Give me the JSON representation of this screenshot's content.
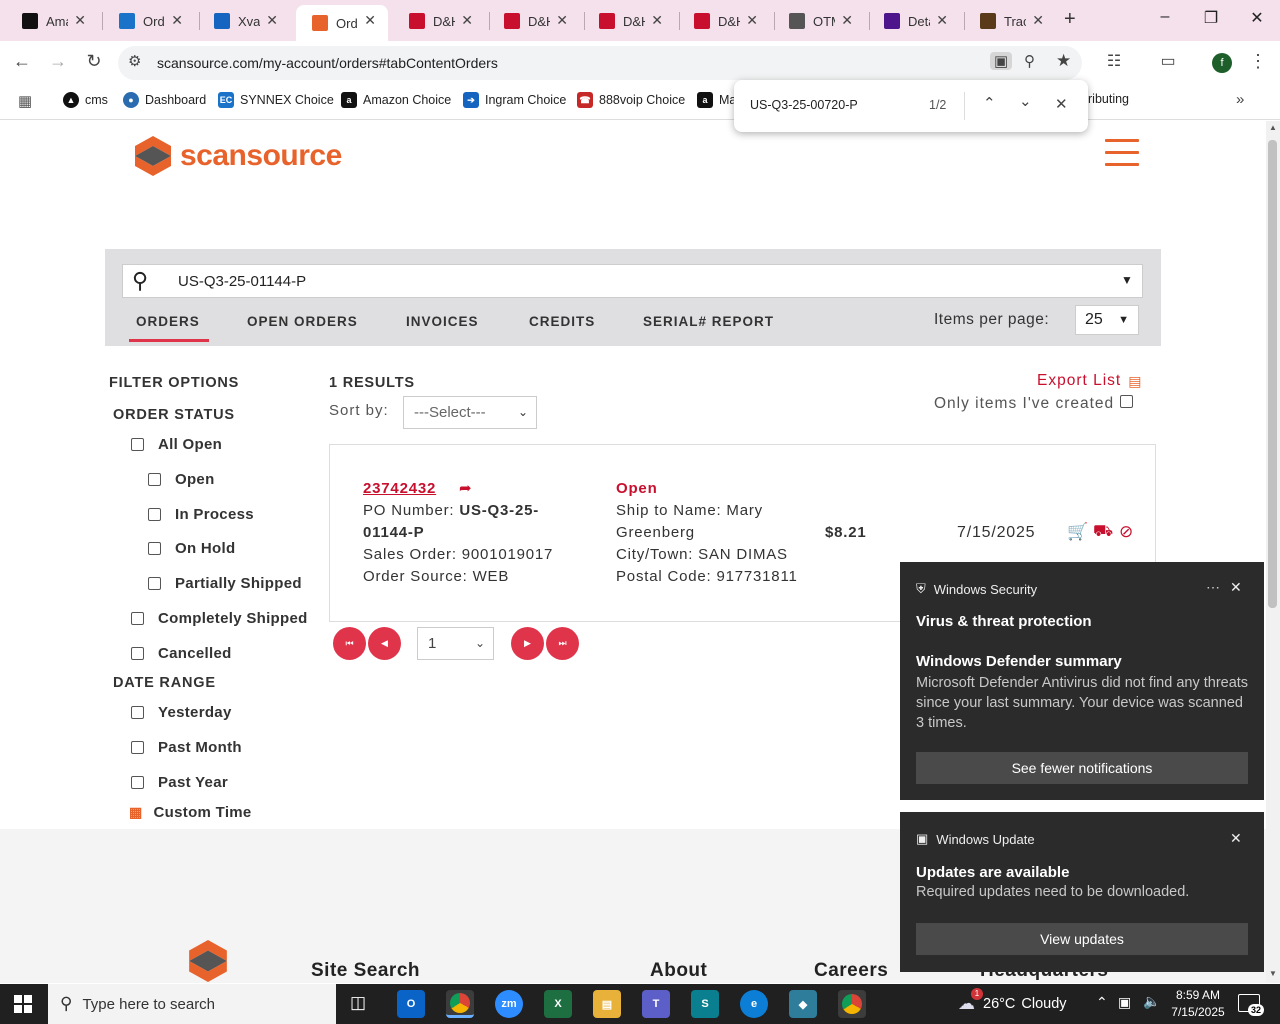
{
  "browser": {
    "tabs": [
      {
        "label": "Ama",
        "icon": "amazon-icon",
        "color": "#111111"
      },
      {
        "label": "Orde",
        "icon": "ec-icon",
        "color": "#1a73c8"
      },
      {
        "label": "Xvan",
        "icon": "xvantage-icon",
        "color": "#1565c0"
      },
      {
        "label": "Orde",
        "icon": "scansource-icon",
        "color": "#e8632b",
        "active": true
      },
      {
        "label": "D&H",
        "icon": "dh-icon",
        "color": "#c8102e"
      },
      {
        "label": "D&H",
        "icon": "dh-icon",
        "color": "#c8102e"
      },
      {
        "label": "D&H",
        "icon": "dh-icon",
        "color": "#c8102e"
      },
      {
        "label": "D&H",
        "icon": "dh-icon",
        "color": "#c8102e"
      },
      {
        "label": "OTM",
        "icon": "otm-icon",
        "color": "#555555"
      },
      {
        "label": "Deta",
        "icon": "fedex-icon",
        "color": "#4d148c"
      },
      {
        "label": "Tracl",
        "icon": "ups-icon",
        "color": "#5b3a1a"
      }
    ],
    "url": "scansource.com/my-account/orders#tabContentOrders",
    "bookmarks": [
      {
        "label": "cms"
      },
      {
        "label": "Dashboard"
      },
      {
        "label": "SYNNEX Choice"
      },
      {
        "label": "Amazon Choice"
      },
      {
        "label": "Ingram Choice"
      },
      {
        "label": "888voip Choice"
      },
      {
        "label": "Ma"
      },
      {
        "label": "ributing"
      }
    ],
    "find": {
      "query": "US-Q3-25-00720-P",
      "count": "1/2"
    },
    "profile_letter": "f"
  },
  "site": {
    "logo_text": "scansource",
    "search_value": "US-Q3-25-01144-P",
    "tabs": [
      "ORDERS",
      "OPEN ORDERS",
      "INVOICES",
      "CREDITS",
      "SERIAL# REPORT"
    ],
    "items_per_page_label": "Items per page:",
    "items_per_page_value": "25",
    "filter_title": "FILTER OPTIONS",
    "order_status_title": "ORDER STATUS",
    "order_status": [
      "All Open",
      "Open",
      "In Process",
      "On Hold",
      "Partially Shipped",
      "Completely Shipped",
      "Cancelled"
    ],
    "date_range_title": "DATE RANGE",
    "date_range": [
      "Yesterday",
      "Past Month",
      "Past Year"
    ],
    "custom_time": "Custom Time",
    "results_count": "1 RESULTS",
    "sort_label": "Sort by:",
    "sort_value": "---Select---",
    "export_label": "Export List",
    "only_mine_label": "Only items I've created",
    "order": {
      "number": "23742432",
      "po_label": "PO Number:",
      "po_line1": "US-Q3-25-",
      "po_line2": "01144-P",
      "sales_order": "Sales Order: 9001019017",
      "order_source": "Order Source: WEB",
      "status": "Open",
      "ship_to_1": "Ship to Name: Mary",
      "ship_to_2": "Greenberg",
      "city": "City/Town: SAN DIMAS",
      "postal": "Postal Code: 917731811",
      "amount": "$8.21",
      "date": "7/15/2025"
    },
    "page_select": "1",
    "footer": {
      "site_search": "Site Search",
      "about": "About",
      "careers": "Careers",
      "headquarters": "Headquarters"
    }
  },
  "notifications": {
    "security": {
      "app": "Windows Security",
      "title": "Virus & threat protection",
      "subtitle": "Windows Defender summary",
      "body": "Microsoft Defender Antivirus did not find any threats since your last summary.  Your device was scanned 3 times.",
      "button": "See fewer notifications"
    },
    "update": {
      "app": "Windows Update",
      "title": "Updates are available",
      "body": "Required updates need to be downloaded.",
      "button": "View updates"
    }
  },
  "taskbar": {
    "search_placeholder": "Type here to search",
    "weather_temp": "26°C",
    "weather_text": "Cloudy",
    "weather_badge": "1",
    "time": "8:59 AM",
    "date": "7/15/2025",
    "notif_count": "32"
  }
}
